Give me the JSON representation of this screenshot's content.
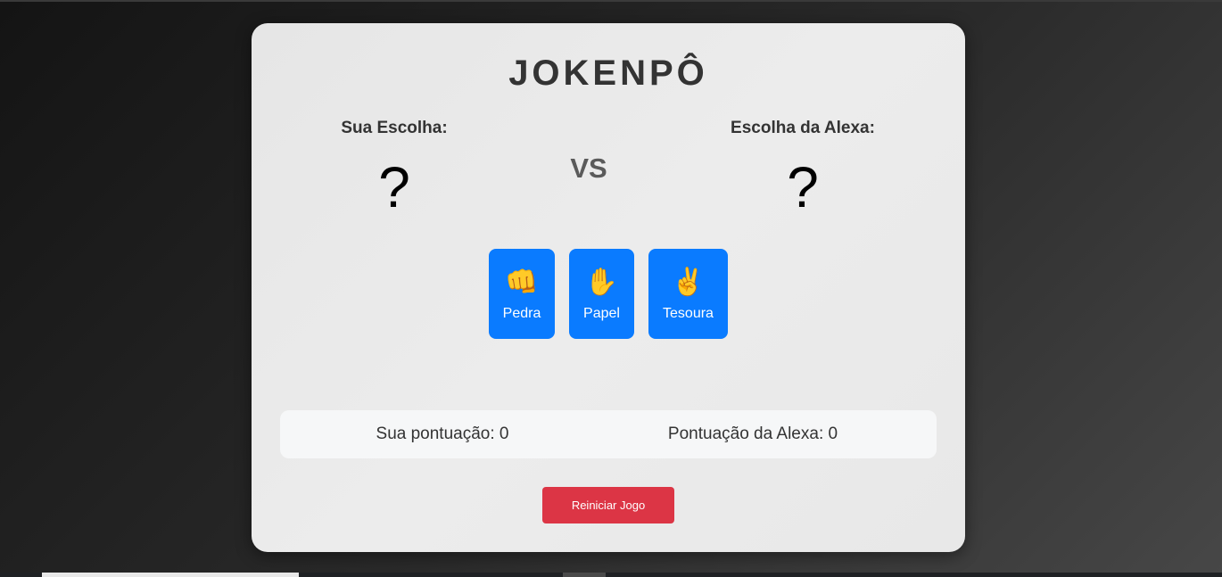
{
  "game": {
    "title": "JOKENPÔ",
    "player_label": "Sua Escolha:",
    "opponent_label": "Escolha da Alexa:",
    "player_choice": "?",
    "opponent_choice": "?",
    "vs_text": "VS"
  },
  "moves": [
    {
      "emoji": "👊",
      "label": "Pedra",
      "icon": "fist-icon"
    },
    {
      "emoji": "✋",
      "label": "Papel",
      "icon": "raised-hand-icon"
    },
    {
      "emoji": "✌️",
      "label": "Tesoura",
      "icon": "victory-hand-icon"
    }
  ],
  "scores": {
    "player": "Sua pontuação: 0",
    "opponent": "Pontuação da Alexa: 0"
  },
  "reset_label": "Reiniciar Jogo",
  "colors": {
    "move_button": "#0a7bff",
    "reset_button": "#dc3545",
    "card_bg": "#e8e8e8"
  }
}
